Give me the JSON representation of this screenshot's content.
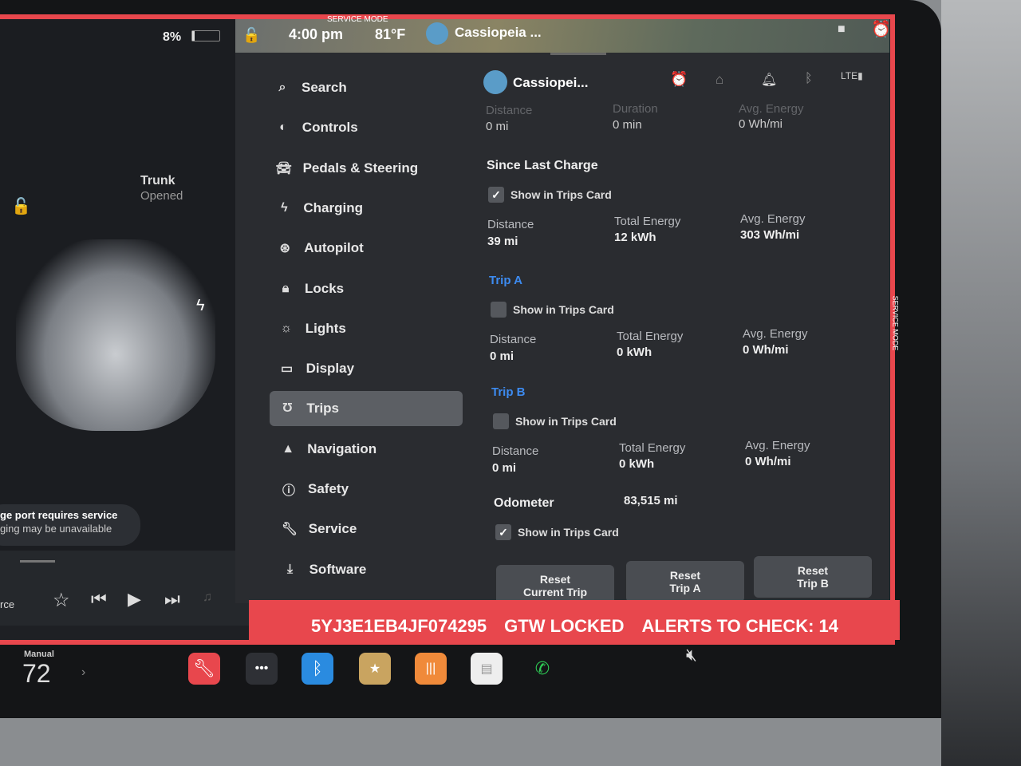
{
  "status": {
    "battery": "8%",
    "time": "4:00 pm",
    "temp": "81°F",
    "profile": "Cassiopeia ...",
    "service_mode": "SERVICE MODE"
  },
  "car": {
    "trunk_label": "Trunk",
    "trunk_state": "Opened",
    "alert_line1": "ge port requires service",
    "alert_line2": "ging may be unavailable"
  },
  "media": {
    "source": "rce"
  },
  "menu": [
    {
      "label": "Search",
      "icon": "search-icon"
    },
    {
      "label": "Controls",
      "icon": "toggle-icon"
    },
    {
      "label": "Pedals & Steering",
      "icon": "car-icon"
    },
    {
      "label": "Charging",
      "icon": "bolt-icon"
    },
    {
      "label": "Autopilot",
      "icon": "steering-wheel-icon"
    },
    {
      "label": "Locks",
      "icon": "lock-icon"
    },
    {
      "label": "Lights",
      "icon": "sun-icon"
    },
    {
      "label": "Display",
      "icon": "display-icon"
    },
    {
      "label": "Trips",
      "icon": "trips-icon",
      "active": true
    },
    {
      "label": "Navigation",
      "icon": "navigation-icon"
    },
    {
      "label": "Safety",
      "icon": "safety-icon"
    },
    {
      "label": "Service",
      "icon": "wrench-icon"
    },
    {
      "label": "Software",
      "icon": "download-icon"
    }
  ],
  "header": {
    "profile": "Cassiopei..."
  },
  "current": {
    "distance_label": "Distance",
    "distance": "0 mi",
    "duration_label": "Duration",
    "duration": "0 min",
    "avg_label": "Avg. Energy",
    "avg": "0 Wh/mi"
  },
  "since_last_charge": {
    "title": "Since Last Charge",
    "show": "Show in Trips Card",
    "checked": true,
    "distance_label": "Distance",
    "distance": "39 mi",
    "energy_label": "Total Energy",
    "energy": "12 kWh",
    "avg_label": "Avg. Energy",
    "avg": "303 Wh/mi"
  },
  "trip_a": {
    "title": "Trip A",
    "show": "Show in Trips Card",
    "checked": false,
    "distance_label": "Distance",
    "distance": "0 mi",
    "energy_label": "Total Energy",
    "energy": "0 kWh",
    "avg_label": "Avg. Energy",
    "avg": "0 Wh/mi"
  },
  "trip_b": {
    "title": "Trip B",
    "show": "Show in Trips Card",
    "checked": false,
    "distance_label": "Distance",
    "distance": "0 mi",
    "energy_label": "Total Energy",
    "energy": "0 kWh",
    "avg_label": "Avg. Energy",
    "avg": "0 Wh/mi"
  },
  "odometer": {
    "label": "Odometer",
    "value": "83,515 mi",
    "show": "Show in Trips Card",
    "checked": true
  },
  "buttons": {
    "reset_current_1": "Reset",
    "reset_current_2": "Current Trip",
    "reset_a_1": "Reset",
    "reset_a_2": "Trip A",
    "reset_b_1": "Reset",
    "reset_b_2": "Trip B"
  },
  "banner": {
    "vin": "5YJ3E1EB4JF074295",
    "gtw": "GTW LOCKED",
    "alerts": "ALERTS TO CHECK: 14"
  },
  "climate": {
    "mode": "Manual",
    "temp": "72"
  },
  "colors": {
    "service_red": "#e8474d",
    "accent_blue": "#3d8bf0",
    "alarm_orange": "#f0a020"
  }
}
